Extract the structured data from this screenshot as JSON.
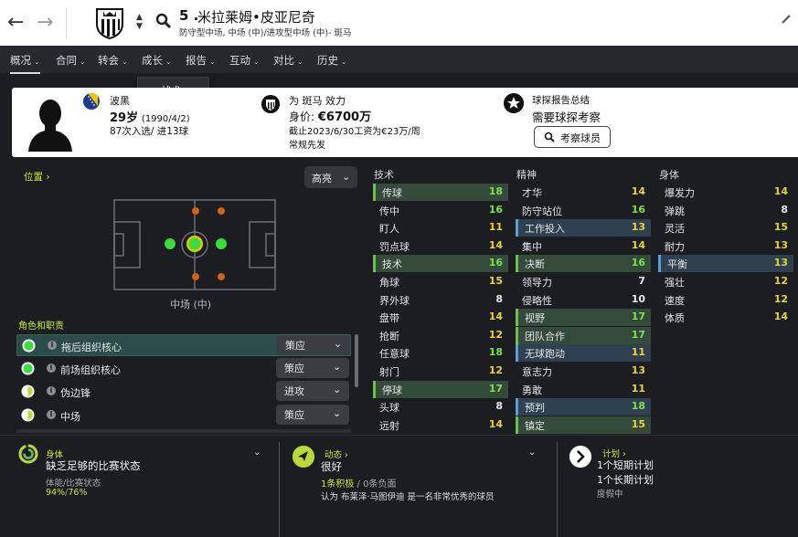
{
  "header": {
    "number": "5 .",
    "name": "米拉莱姆•皮亚尼奇",
    "subtitle": "防守型中场, 中场 (中)/进攻型中场 (中)- 斑马"
  },
  "tabs": [
    {
      "label": "概况"
    },
    {
      "label": "合同"
    },
    {
      "label": "转会"
    },
    {
      "label": "成长"
    },
    {
      "label": "报告"
    },
    {
      "label": "互动"
    },
    {
      "label": "对比"
    },
    {
      "label": "历史"
    }
  ],
  "dropdown": {
    "item": "战术"
  },
  "card": {
    "nationality": "波黑",
    "age": "29岁",
    "dob": "(1990/4/2)",
    "apps": "87次入选/ 进13球",
    "plays_for": "为 斑马 效力",
    "value_label": "身价:",
    "value": "€6700万",
    "contract": "截止2023/6/30工资为€23万/周",
    "status": "常规先发",
    "scout_title": "球探报告总结",
    "scout_need": "需要球探考察",
    "scout_button": "考察球员"
  },
  "position": {
    "link": "位置",
    "detail": "高亮",
    "label": "中场 (中)"
  },
  "roles": {
    "title": "角色和职责",
    "items": [
      {
        "name": "拖后组织核心",
        "duty": "策应",
        "selected": true,
        "rating": "full"
      },
      {
        "name": "前场组织核心",
        "duty": "策应",
        "selected": false,
        "rating": "mostly"
      },
      {
        "name": "伪边锋",
        "duty": "进攻",
        "selected": false,
        "rating": "half"
      },
      {
        "name": "中场",
        "duty": "策应",
        "selected": false,
        "rating": "half"
      }
    ]
  },
  "attributes": {
    "technical": {
      "title": "技术",
      "items": [
        {
          "name": "传球",
          "value": "18",
          "hl": "green"
        },
        {
          "name": "传中",
          "value": "16",
          "hl": ""
        },
        {
          "name": "盯人",
          "value": "11",
          "hl": ""
        },
        {
          "name": "罚点球",
          "value": "14",
          "hl": ""
        },
        {
          "name": "技术",
          "value": "16",
          "hl": "green"
        },
        {
          "name": "角球",
          "value": "15",
          "hl": ""
        },
        {
          "name": "界外球",
          "value": "8",
          "hl": ""
        },
        {
          "name": "盘带",
          "value": "14",
          "hl": ""
        },
        {
          "name": "抢断",
          "value": "12",
          "hl": ""
        },
        {
          "name": "任意球",
          "value": "18",
          "hl": ""
        },
        {
          "name": "射门",
          "value": "12",
          "hl": ""
        },
        {
          "name": "停球",
          "value": "17",
          "hl": "green"
        },
        {
          "name": "头球",
          "value": "8",
          "hl": ""
        },
        {
          "name": "远射",
          "value": "14",
          "hl": ""
        }
      ]
    },
    "mental": {
      "title": "精神",
      "items": [
        {
          "name": "才华",
          "value": "14",
          "hl": ""
        },
        {
          "name": "防守站位",
          "value": "16",
          "hl": ""
        },
        {
          "name": "工作投入",
          "value": "13",
          "hl": "blue"
        },
        {
          "name": "集中",
          "value": "14",
          "hl": ""
        },
        {
          "name": "决断",
          "value": "16",
          "hl": "green"
        },
        {
          "name": "领导力",
          "value": "7",
          "hl": ""
        },
        {
          "name": "侵略性",
          "value": "10",
          "hl": ""
        },
        {
          "name": "视野",
          "value": "17",
          "hl": "green"
        },
        {
          "name": "团队合作",
          "value": "17",
          "hl": "green"
        },
        {
          "name": "无球跑动",
          "value": "11",
          "hl": "blue"
        },
        {
          "name": "意志力",
          "value": "13",
          "hl": ""
        },
        {
          "name": "勇敢",
          "value": "11",
          "hl": ""
        },
        {
          "name": "预判",
          "value": "18",
          "hl": "blue"
        },
        {
          "name": "镇定",
          "value": "15",
          "hl": "green"
        }
      ]
    },
    "physical": {
      "title": "身体",
      "items": [
        {
          "name": "爆发力",
          "value": "14",
          "hl": ""
        },
        {
          "name": "弹跳",
          "value": "8",
          "hl": ""
        },
        {
          "name": "灵活",
          "value": "15",
          "hl": ""
        },
        {
          "name": "耐力",
          "value": "13",
          "hl": ""
        },
        {
          "name": "平衡",
          "value": "13",
          "hl": "blue"
        },
        {
          "name": "强壮",
          "value": "12",
          "hl": ""
        },
        {
          "name": "速度",
          "value": "12",
          "hl": ""
        },
        {
          "name": "体质",
          "value": "14",
          "hl": ""
        }
      ]
    }
  },
  "bottom": {
    "fitness": {
      "label": "身体",
      "main": "缺乏足够的比赛状态",
      "sub": "体能/比赛状态",
      "v1": "94%",
      "slash": "/",
      "v2": "76%",
      "condition": 0.94,
      "sharpness": 0.76
    },
    "morale": {
      "label": "动态",
      "main": "很好",
      "pos": "1条积极",
      "slash": " /",
      "neg": "0条负面",
      "note": "认为 布莱泽·马图伊迪 是一名非常优秀的球员"
    },
    "plans": {
      "label": "计划",
      "short": "1个短期计划",
      "long": "1个长期计划",
      "status": "度假中"
    }
  },
  "colors": {
    "accent": "#c8e63c",
    "high": "#7fe04a",
    "mid": "#e8d23a",
    "low": "#e6e6e6"
  }
}
